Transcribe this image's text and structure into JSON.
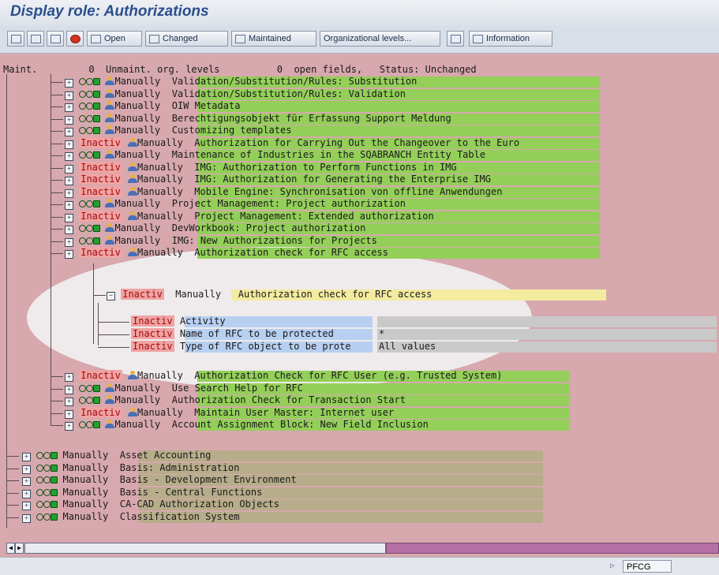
{
  "window": {
    "title": "Display role: Authorizations"
  },
  "toolbar": {
    "open": "Open",
    "changed": "Changed",
    "maintained": "Maintained",
    "org_levels": "Organizational levels...",
    "information": "Information"
  },
  "header_line": "Maint.         0  Unmaint. org. levels          0  open fields,   Status: Unchanged",
  "group_rows": [
    {
      "status": "lights",
      "text": "Validation/Substitution/Rules: Substitution"
    },
    {
      "status": "lights",
      "text": "Validation/Substitution/Rules: Validation"
    },
    {
      "status": "lights",
      "text": "OIW Metadata"
    },
    {
      "status": "lights",
      "text": "Berechtigungsobjekt für Erfassung Support Meldung"
    },
    {
      "status": "lights",
      "text": "Customizing templates"
    },
    {
      "status": "Inactiv",
      "text": "Authorization for Carrying Out the Changeover to the Euro"
    },
    {
      "status": "lights",
      "text": "Maintenance of Industries in the SQABRANCH Entity Table"
    },
    {
      "status": "Inactiv",
      "text": "IMG: Authorization to Perform Functions in IMG"
    },
    {
      "status": "Inactiv",
      "text": "IMG: Authorization for Generating the Enterprise IMG"
    },
    {
      "status": "Inactiv",
      "text": "Mobile Engine: Synchronisation von offline Anwendungen"
    },
    {
      "status": "lights",
      "text": "Project Management: Project authorization"
    },
    {
      "status": "Inactiv",
      "text": "Project Management: Extended authorization"
    },
    {
      "status": "lights",
      "text": "DevWorkbook: Project authorization"
    },
    {
      "status": "lights",
      "text": "IMG: New Authorizations for Projects"
    },
    {
      "status": "Inactiv",
      "text": "Authorization check for RFC access"
    }
  ],
  "manually": "Manually",
  "inactiv": "Inactiv",
  "sub_node": {
    "status": "Inactiv",
    "label": "Manually",
    "text": "Authorization check for RFC access"
  },
  "fields": [
    {
      "status": "Inactiv",
      "name": "Activity",
      "value": ""
    },
    {
      "status": "Inactiv",
      "name": "Name of RFC to be protected",
      "value": "*"
    },
    {
      "status": "Inactiv",
      "name": "Type of RFC object to be prote",
      "value": "All values"
    }
  ],
  "group_rows_2": [
    {
      "status": "Inactiv",
      "text": "Authorization Check for RFC User (e.g. Trusted System)"
    },
    {
      "status": "lights",
      "text": "Use Search Help for RFC"
    },
    {
      "status": "lights",
      "text": "Authorization Check for Transaction Start"
    },
    {
      "status": "Inactiv",
      "text": "Maintain User Master: Internet user"
    },
    {
      "status": "lights",
      "text": "Account Assignment Block: New Field Inclusion"
    }
  ],
  "top_rows": [
    {
      "text": "Asset Accounting"
    },
    {
      "text": "Basis: Administration"
    },
    {
      "text": "Basis - Development Environment"
    },
    {
      "text": "Basis - Central Functions"
    },
    {
      "text": "CA-CAD Authorization Objects"
    },
    {
      "text": "Classification System"
    }
  ],
  "status_bar": {
    "transaction": "PFCG"
  }
}
